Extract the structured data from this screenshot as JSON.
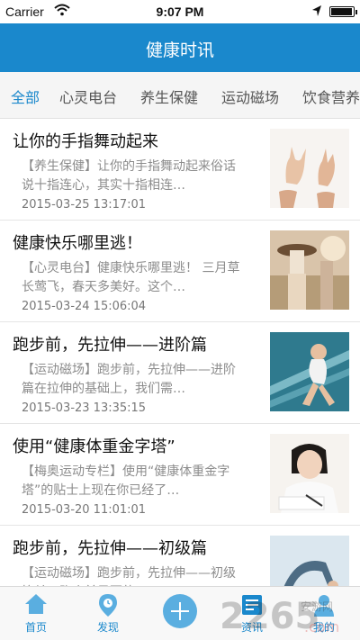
{
  "status_bar": {
    "carrier": "Carrier",
    "time": "9:07 PM",
    "battery_level": 0.95
  },
  "nav": {
    "title": "健康时讯"
  },
  "tabs": [
    {
      "label": "全部",
      "active": true
    },
    {
      "label": "心灵电台",
      "active": false
    },
    {
      "label": "养生保健",
      "active": false
    },
    {
      "label": "运动磁场",
      "active": false
    },
    {
      "label": "饮食营养",
      "active": false
    }
  ],
  "news": [
    {
      "title": "让你的手指舞动起来",
      "summary": "【养生保健】让你的手指舞动起来俗话说十指连心，其实十指相连…",
      "date": "2015-03-25 13:17:01",
      "thumb": "hands-image"
    },
    {
      "title": "健康快乐哪里逃！",
      "summary": "【心灵电台】健康快乐哪里逃！ 三月草长莺飞，春天多美好。这个…",
      "date": "2015-03-24 15:06:04",
      "thumb": "girls-field-image"
    },
    {
      "title": "跑步前，先拉伸——进阶篇",
      "summary": "【运动磁场】跑步前，先拉伸——进阶篇在拉伸的基础上，我们需…",
      "date": "2015-03-23 13:35:15",
      "thumb": "stretch-woman-image"
    },
    {
      "title": "使用“健康体重金字塔”",
      "summary": "【梅奥运动专栏】使用“健康体重金字塔”的贴士上现在你已经了…",
      "date": "2015-03-20 11:01:01",
      "thumb": "writing-girl-image"
    },
    {
      "title": "跑步前，先拉伸——初级篇",
      "summary": "【运动磁场】跑步前，先拉伸——初级篇关于跑步前是否的…",
      "date": "",
      "thumb": "yoga-image"
    }
  ],
  "tab_bar": {
    "home": "首页",
    "discover": "发现",
    "news": "资讯",
    "mine": "我的"
  },
  "watermark": {
    "text": "2265",
    "subtext": ".com",
    "site": "安游网"
  },
  "colors": {
    "accent": "#1a88cc",
    "muted": "#8c8c8c"
  }
}
